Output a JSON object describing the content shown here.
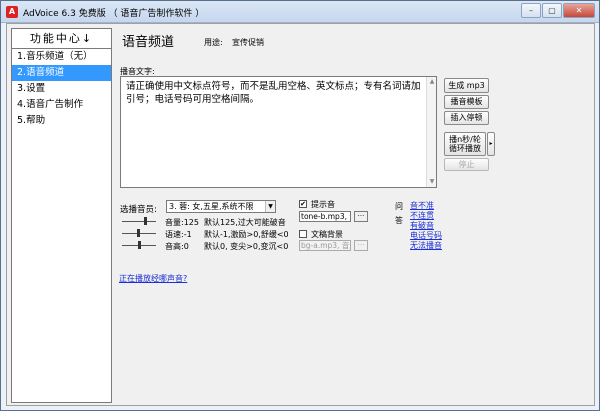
{
  "window": {
    "icon_letter": "A",
    "title": "AdVoice 6.3 免费版 （ 语音广告制作软件 ）",
    "controls": [
      "–",
      "▢",
      "✕"
    ]
  },
  "sidebar": {
    "header": "功能中心",
    "header_arrow": "↓",
    "items": [
      {
        "label": "1.音乐频道（无）"
      },
      {
        "label": "2.语音频道",
        "selected": true
      },
      {
        "label": "3.设置"
      },
      {
        "label": "4.语音广告制作"
      },
      {
        "label": "5.帮助"
      }
    ]
  },
  "main": {
    "title": "语音频道",
    "use_label": "用途:",
    "use_value": "宣传促销",
    "broadcast_label": "播音文字:",
    "broadcast_text": "请正确使用中文标点符号，而不是乱用空格、英文标点；专有名词请加引号；电话号码可用空格间隔。"
  },
  "buttons": {
    "generate_mp3": "生成 mp3",
    "broadcast_template": "播音模板",
    "insert_pause": "插入停顿",
    "broadcast_line1": "播n秒/轮",
    "broadcast_line2": "循环播放",
    "stop": "停止"
  },
  "voice": {
    "label": "选播音员:",
    "selected": "3. 蓉: 女,五星,系统不限",
    "params": [
      {
        "name": "音量:125",
        "desc": "默认125,过大可能破音",
        "level": 0.7
      },
      {
        "name": "语速:-1",
        "desc": "默认-1,激励>0,舒缓<0",
        "level": 0.48
      },
      {
        "name": "音高:0",
        "desc": "默认0, 变尖>0,变沉<0",
        "level": 0.5
      }
    ]
  },
  "options": {
    "prompt_sound_label": "提示音",
    "prompt_sound_checked": true,
    "prompt_sound_file": "tone-b.mp3, 音",
    "bg_music_label": "文稿背景",
    "bg_music_checked": false,
    "bg_music_file": "bg-a.mp3, 音量",
    "dots": "···"
  },
  "qa": {
    "q": "问",
    "a": "答",
    "links": [
      "音不准",
      "不连贯",
      "有破音",
      "电话号码",
      "无法播音"
    ]
  },
  "bottom_link": "正在播放经哪声音?"
}
